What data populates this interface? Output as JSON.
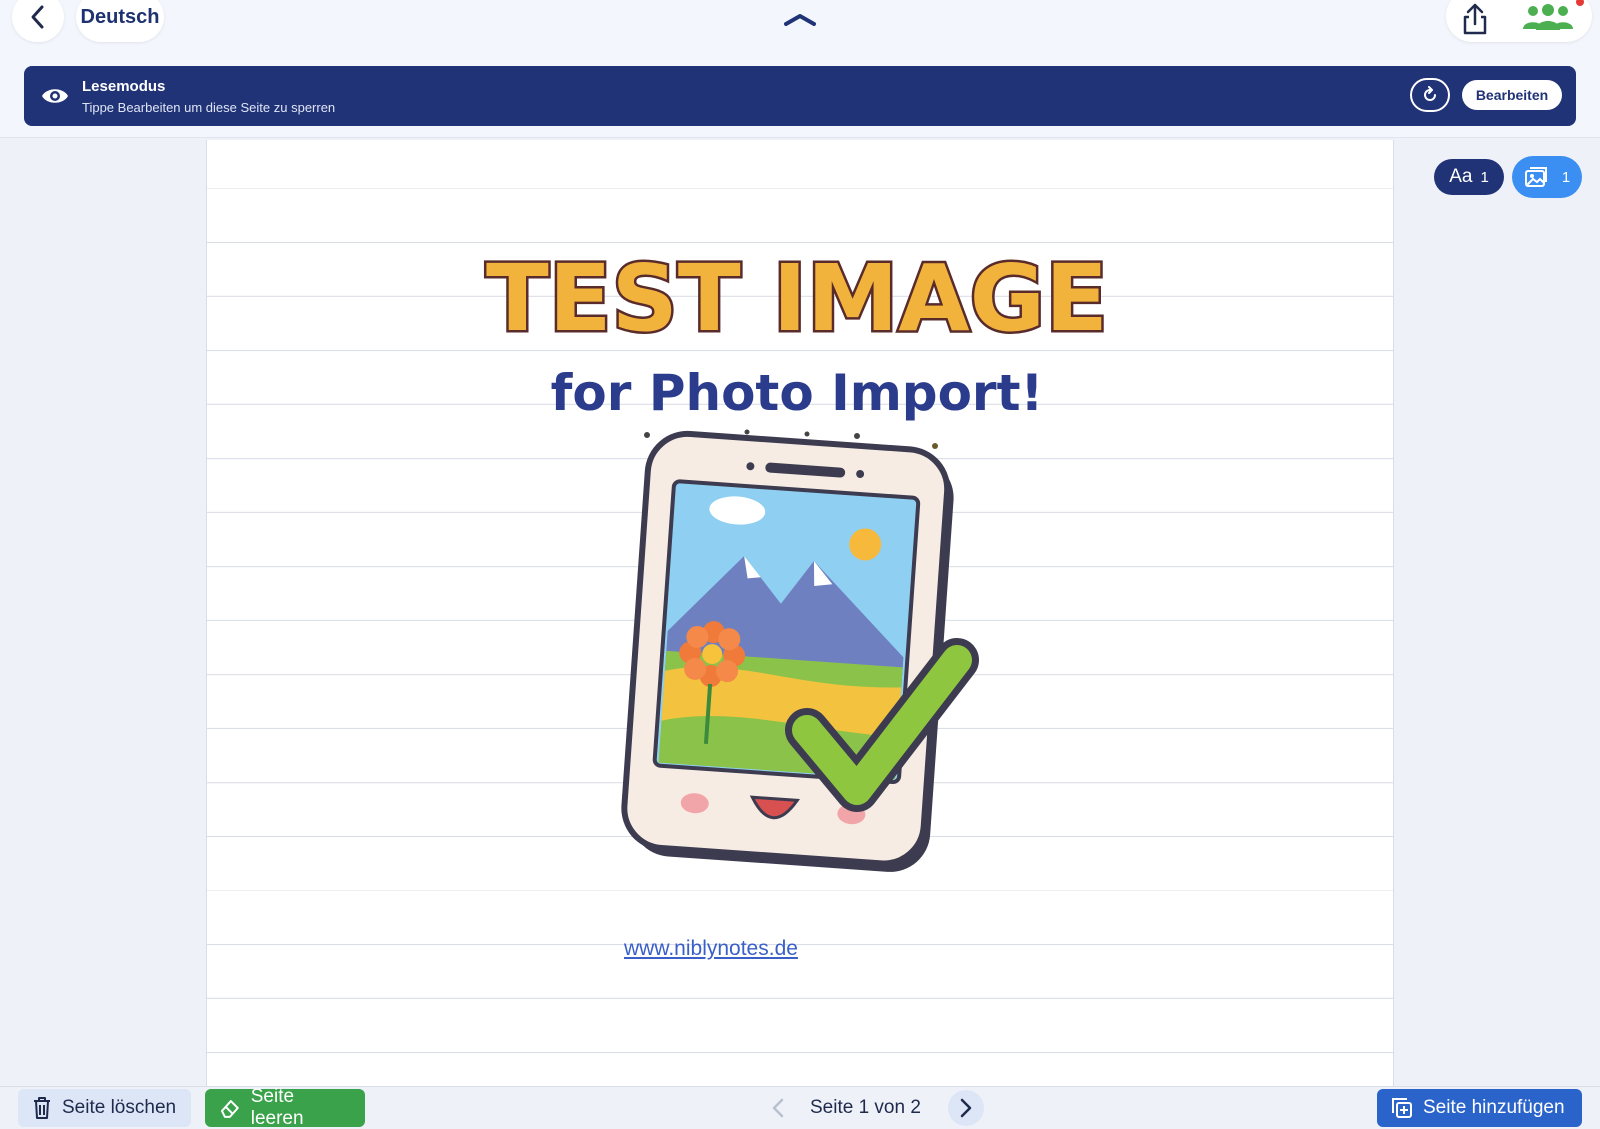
{
  "header": {
    "back_icon": "chevron-left-icon",
    "language": "Deutsch",
    "collapse_icon": "chevron-up-icon",
    "share_icon": "share-icon",
    "collaborators_icon": "people-icon",
    "notification_color": "#e53935"
  },
  "banner": {
    "title": "Lesemodus",
    "subtitle": "Tippe Bearbeiten um diese Seite zu sperren",
    "edit_label": "Bearbeiten",
    "bg_color": "#213377"
  },
  "page": {
    "image_title": "TEST IMAGE",
    "image_subtitle": "for Photo Import!",
    "link": "www.niblynotes.de"
  },
  "counters": {
    "text_label": "Aa",
    "text_count": "1",
    "image_count": "1"
  },
  "toolbar": {
    "delete_label": "Seite löschen",
    "clear_label": "Seite leeren",
    "page_indicator": "Seite 1 von 2",
    "add_label": "Seite hinzufügen"
  }
}
